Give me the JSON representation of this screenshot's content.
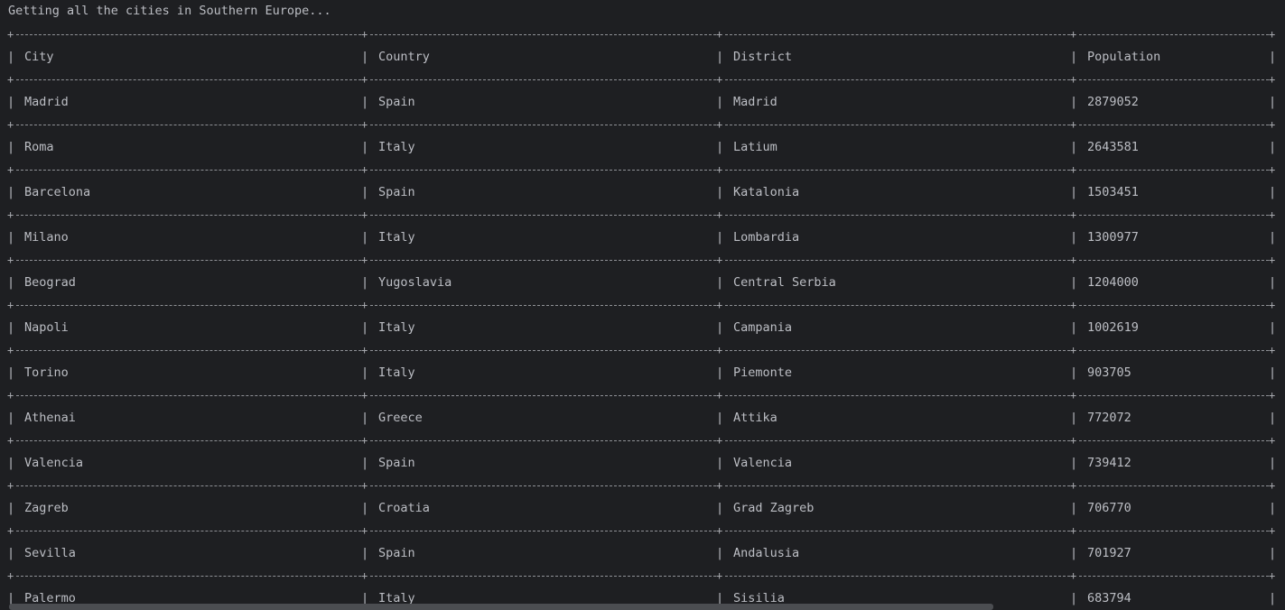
{
  "console": {
    "status_text": "Getting all the cities in Southern Europe...",
    "table": {
      "headers": [
        "City",
        "Country",
        "District",
        "Population"
      ],
      "rows": [
        [
          "Madrid",
          "Spain",
          "Madrid",
          "2879052"
        ],
        [
          "Roma",
          "Italy",
          "Latium",
          "2643581"
        ],
        [
          "Barcelona",
          "Spain",
          "Katalonia",
          "1503451"
        ],
        [
          "Milano",
          "Italy",
          "Lombardia",
          "1300977"
        ],
        [
          "Beograd",
          "Yugoslavia",
          "Central Serbia",
          "1204000"
        ],
        [
          "Napoli",
          "Italy",
          "Campania",
          "1002619"
        ],
        [
          "Torino",
          "Italy",
          "Piemonte",
          "903705"
        ],
        [
          "Athenai",
          "Greece",
          "Attika",
          "772072"
        ],
        [
          "Valencia",
          "Spain",
          "Valencia",
          "739412"
        ],
        [
          "Zagreb",
          "Croatia",
          "Grad Zagreb",
          "706770"
        ],
        [
          "Sevilla",
          "Spain",
          "Andalusia",
          "701927"
        ],
        [
          "Palermo",
          "Italy",
          "Sisilia",
          "683794"
        ]
      ]
    },
    "colors": {
      "background": "#1e1f22",
      "text": "#bcbec4",
      "border": "#8f9196",
      "scrollbar": "#4b4d51"
    }
  }
}
